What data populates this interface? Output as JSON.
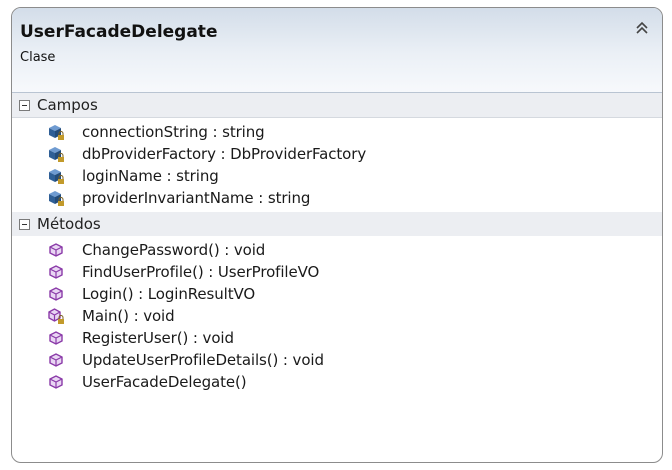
{
  "class": {
    "name": "UserFacadeDelegate",
    "stereotype": "Clase"
  },
  "sections": {
    "fields": {
      "title": "Campos",
      "items": [
        {
          "label": "connectionString : string",
          "icon": "private-field-icon"
        },
        {
          "label": "dbProviderFactory : DbProviderFactory",
          "icon": "private-field-icon"
        },
        {
          "label": "loginName : string",
          "icon": "private-field-icon"
        },
        {
          "label": "providerInvariantName : string",
          "icon": "private-field-icon"
        }
      ]
    },
    "methods": {
      "title": "Métodos",
      "items": [
        {
          "label": "ChangePassword() : void",
          "icon": "public-method-icon"
        },
        {
          "label": "FindUserProfile() : UserProfileVO",
          "icon": "public-method-icon"
        },
        {
          "label": "Login() : LoginResultVO",
          "icon": "public-method-icon"
        },
        {
          "label": "Main() : void",
          "icon": "private-method-icon"
        },
        {
          "label": "RegisterUser() : void",
          "icon": "public-method-icon"
        },
        {
          "label": "UpdateUserProfileDetails() : void",
          "icon": "public-method-icon"
        },
        {
          "label": "UserFacadeDelegate()",
          "icon": "public-method-icon"
        }
      ]
    }
  },
  "colors": {
    "field_icon": "#2f5f96",
    "method_icon": "#8a3aa8",
    "lock": "#c29a2b"
  }
}
